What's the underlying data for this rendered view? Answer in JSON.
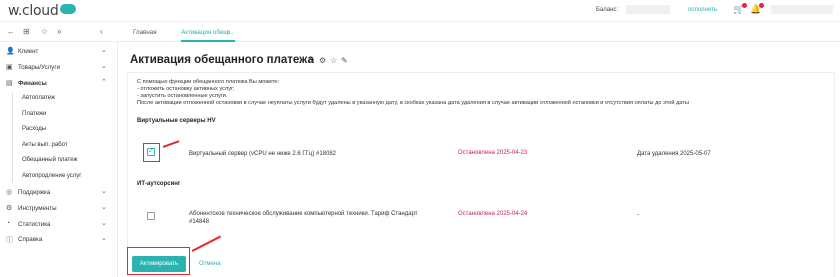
{
  "header": {
    "logo": "w.cloud",
    "balance_label": "Баланс:",
    "topup_label": "пополнить"
  },
  "tabs": [
    {
      "label": "Главная"
    },
    {
      "label": "Активация обещ..."
    }
  ],
  "sidebar": {
    "items": [
      {
        "label": "Клиент"
      },
      {
        "label": "Товары/Услуги"
      },
      {
        "label": "Финансы"
      },
      {
        "label": "Поддержка"
      },
      {
        "label": "Инструменты"
      },
      {
        "label": "Статистика"
      },
      {
        "label": "Справка"
      }
    ],
    "finance_sub": [
      {
        "label": "Автоплатеж"
      },
      {
        "label": "Платежи"
      },
      {
        "label": "Расходы"
      },
      {
        "label": "Акты вып. работ"
      },
      {
        "label": "Обещанный платеж"
      },
      {
        "label": "Автопродление услуг"
      }
    ]
  },
  "page": {
    "title": "Активация обещанного платежа",
    "intro": [
      "С помощью функции обещанного платежа Вы можете:",
      "- отложить остановку активных услуг;",
      "- запустить остановленные услуги.",
      "После активации отложенной остановки в случае неуплаты услуги будут удалены в указанную дату, в скобках указана дата удаления в случае активации отложенной остановки и отсутствия оплаты до этой даты"
    ],
    "sections": [
      {
        "title": "Виртуальные серверы HV",
        "rows": [
          {
            "name": "Виртуальный сервер (vCPU не ниже 2.6 ГГц) #18082",
            "status": "Остановлена 2025-04-23",
            "delete_date": "Дата удаления 2025-05-07",
            "checked": true
          }
        ]
      },
      {
        "title": "ИТ-аутсорсинг",
        "rows": [
          {
            "name_line1": "Абонентское техническое обслуживание компьютерной техники. Тариф Стандарт",
            "name_line2": "#14848",
            "status": "Остановлена 2025-04-24",
            "delete_date": "-",
            "checked": false
          }
        ]
      }
    ],
    "activate_label": "Активировать",
    "cancel_label": "Отмена"
  },
  "colors": {
    "accent": "#2bb3b1",
    "status": "#c0245a",
    "highlight": "#e32b2b"
  }
}
